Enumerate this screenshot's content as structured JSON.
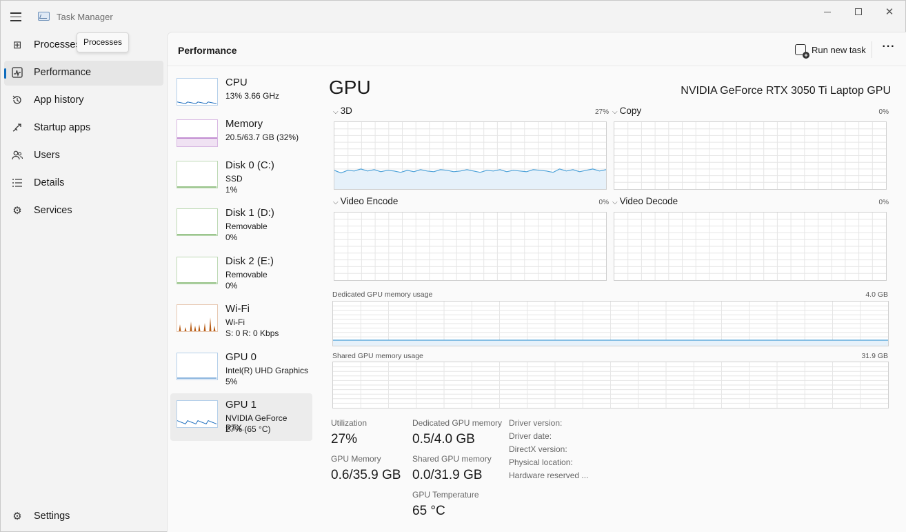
{
  "app": {
    "title": "Task Manager",
    "window_controls": {
      "minimize": "minimize-icon",
      "maximize": "maximize-icon",
      "close": "close-icon"
    }
  },
  "nav": {
    "items": [
      {
        "label": "Processes",
        "icon": "processes-icon"
      },
      {
        "label": "Performance",
        "icon": "performance-icon",
        "active": true
      },
      {
        "label": "App history",
        "icon": "history-icon"
      },
      {
        "label": "Startup apps",
        "icon": "startup-icon"
      },
      {
        "label": "Users",
        "icon": "users-icon"
      },
      {
        "label": "Details",
        "icon": "details-icon"
      },
      {
        "label": "Services",
        "icon": "services-icon"
      }
    ],
    "settings": "Settings",
    "tooltip": "Processes"
  },
  "header": {
    "title": "Performance",
    "run_new_task": "Run new task",
    "more": "···"
  },
  "devices": [
    {
      "name": "CPU",
      "line1": "13%  3.66 GHz",
      "line2": "",
      "color": "#1e6fbf"
    },
    {
      "name": "Memory",
      "line1": "20.5/63.7 GB (32%)",
      "line2": "",
      "color": "#8b28a8"
    },
    {
      "name": "Disk 0 (C:)",
      "line1": "SSD",
      "line2": "1%",
      "color": "#3a8c1e"
    },
    {
      "name": "Disk 1 (D:)",
      "line1": "Removable",
      "line2": "0%",
      "color": "#3a8c1e"
    },
    {
      "name": "Disk 2 (E:)",
      "line1": "Removable",
      "line2": "0%",
      "color": "#3a8c1e"
    },
    {
      "name": "Wi-Fi",
      "line1": "Wi-Fi",
      "line2": "S: 0  R: 0 Kbps",
      "color": "#b75b14"
    },
    {
      "name": "GPU 0",
      "line1": "Intel(R) UHD Graphics",
      "line2": "5%",
      "color": "#1e6fbf"
    },
    {
      "name": "GPU 1",
      "line1": "NVIDIA GeForce RTX...",
      "line2": "27%  (65 °C)",
      "color": "#1e6fbf",
      "active": true
    }
  ],
  "gpu": {
    "title": "GPU",
    "model": "NVIDIA GeForce RTX 3050 Ti Laptop GPU",
    "engines": [
      {
        "label": "3D",
        "pct": "27%"
      },
      {
        "label": "Copy",
        "pct": "0%"
      },
      {
        "label": "Video Encode",
        "pct": "0%"
      },
      {
        "label": "Video Decode",
        "pct": "0%"
      }
    ],
    "dedicated_label": "Dedicated GPU memory usage",
    "dedicated_max": "4.0 GB",
    "shared_label": "Shared GPU memory usage",
    "shared_max": "31.9 GB",
    "stats": {
      "utilization_label": "Utilization",
      "utilization": "27%",
      "dedicated_mem_label": "Dedicated GPU memory",
      "dedicated_mem": "0.5/4.0 GB",
      "gpu_mem_label": "GPU Memory",
      "gpu_mem": "0.6/35.9 GB",
      "shared_mem_label": "Shared GPU memory",
      "shared_mem": "0.0/31.9 GB",
      "temp_label": "GPU Temperature",
      "temp": "65 °C"
    },
    "driver_keys": [
      "Driver version:",
      "Driver date:",
      "DirectX version:",
      "Physical location:",
      "Hardware reserved ..."
    ]
  },
  "colors": {
    "accent": "#0f6cbd",
    "graph_line": "#4aa0d8",
    "grid": "#e6e6e6"
  }
}
